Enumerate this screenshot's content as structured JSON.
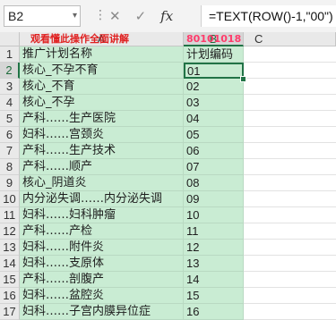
{
  "formula_bar": {
    "name_box": "B2",
    "dots": "⋮",
    "cancel_icon": "✕",
    "enter_icon": "✓",
    "fx_label": "fx",
    "formula": "=TEXT(ROW()-1,\"00\")"
  },
  "columns": {
    "a": "A",
    "b": "B",
    "c": "C"
  },
  "banner_text": {
    "left": "观看懂此操作全面讲解",
    "right": "80101018 "
  },
  "rows": [
    {
      "num": "1",
      "a": "推广计划名称",
      "b": "计划编码"
    },
    {
      "num": "2",
      "a": "核心_不孕不育",
      "b": "01"
    },
    {
      "num": "3",
      "a": "核心_不育",
      "b": "02"
    },
    {
      "num": "4",
      "a": "核心_不孕",
      "b": "03"
    },
    {
      "num": "5",
      "a": "产科……生产医院",
      "b": "04"
    },
    {
      "num": "6",
      "a": "妇科……宫颈炎",
      "b": "05"
    },
    {
      "num": "7",
      "a": "产科……生产技术",
      "b": "06"
    },
    {
      "num": "8",
      "a": "产科……顺产",
      "b": "07"
    },
    {
      "num": "9",
      "a": "核心_阴道炎",
      "b": "08"
    },
    {
      "num": "10",
      "a": "内分泌失调……内分泌失调",
      "b": "09"
    },
    {
      "num": "11",
      "a": "妇科……妇科肿瘤",
      "b": "10"
    },
    {
      "num": "12",
      "a": "产科……产检",
      "b": "11"
    },
    {
      "num": "13",
      "a": "妇科……附件炎",
      "b": "12"
    },
    {
      "num": "14",
      "a": "妇科……支原体",
      "b": "13"
    },
    {
      "num": "15",
      "a": "产科……剖腹产",
      "b": "14"
    },
    {
      "num": "16",
      "a": "妇科……盆腔炎",
      "b": "15"
    },
    {
      "num": "17",
      "a": "妇科……子宫内膜异位症",
      "b": "16"
    }
  ],
  "colors": {
    "fill": "#c9ecd3",
    "selection": "#217346"
  }
}
